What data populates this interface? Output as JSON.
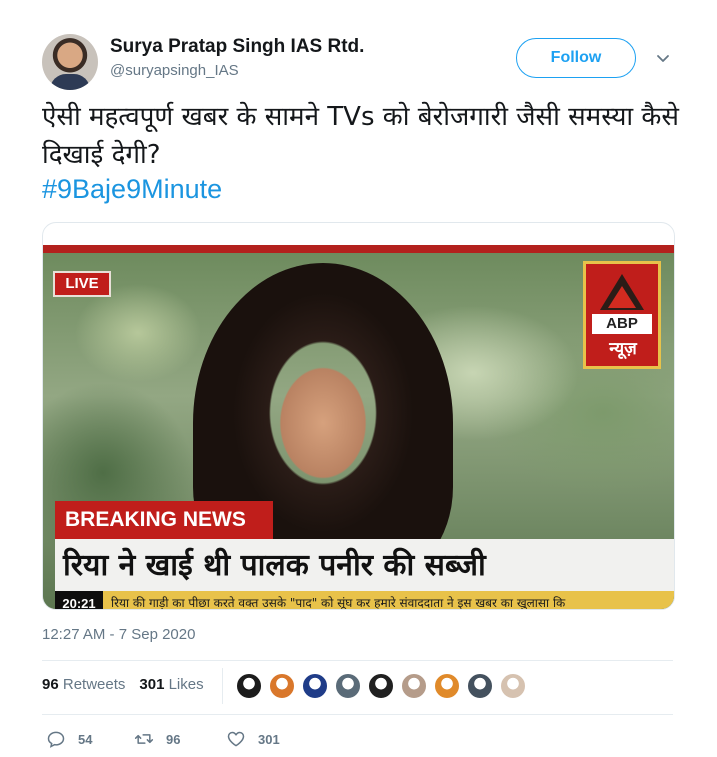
{
  "author": {
    "display_name": "Surya Pratap Singh IAS Rtd.",
    "handle": "@suryapsingh_IAS"
  },
  "follow_button": {
    "label": "Follow"
  },
  "tweet": {
    "text": "ऐसी महत्वपूर्ण खबर के सामने TVs को बेरोजगारी जैसी समस्या कैसे दिखाई देगी?",
    "hashtag": "#9Baje9Minute",
    "timestamp": "12:27 AM - 7 Sep 2020"
  },
  "media": {
    "live_label": "LIVE",
    "channel_logo_text": "ABP",
    "channel_logo_hindi": "न्यूज़",
    "breaking_label": "BREAKING NEWS",
    "headline": "रिया ने खाई थी पालक पनीर की सब्जी",
    "ticker_time": "20:21",
    "ticker_text": "रिया की गाड़ी का पीछा करते वक्त उसके \"पाद\" को सूंघ कर हमारे संवाददाता ने इस खबर का खुलासा कि"
  },
  "stats": {
    "retweets_count": "96",
    "retweets_label": "Retweets",
    "likes_count": "301",
    "likes_label": "Likes"
  },
  "likers": {
    "avatar_colors": [
      "#1c1c1c",
      "#d9772b",
      "#1f3c88",
      "#5a6b78",
      "#202020",
      "#b59c8a",
      "#e08a2a",
      "#44515e",
      "#d6c2b0"
    ]
  },
  "actions": {
    "reply_count": "54",
    "retweet_count": "96",
    "like_count": "301"
  }
}
